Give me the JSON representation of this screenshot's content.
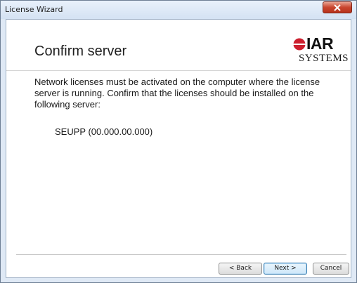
{
  "window": {
    "title": "License Wizard"
  },
  "header": {
    "title": "Confirm server",
    "logo_word": "IAR",
    "logo_sub": "SYSTEMS"
  },
  "content": {
    "message": "Network licenses must be activated on the computer where the license server is running. Confirm that the licenses should be installed on the following server:",
    "server": "SEUPP (00.000.00.000)"
  },
  "buttons": {
    "back": "< Back",
    "next": "Next >",
    "cancel": "Cancel"
  },
  "colors": {
    "logo_red": "#cc1f2e",
    "close_red": "#c9452e",
    "frame": "#dfe9f5"
  }
}
